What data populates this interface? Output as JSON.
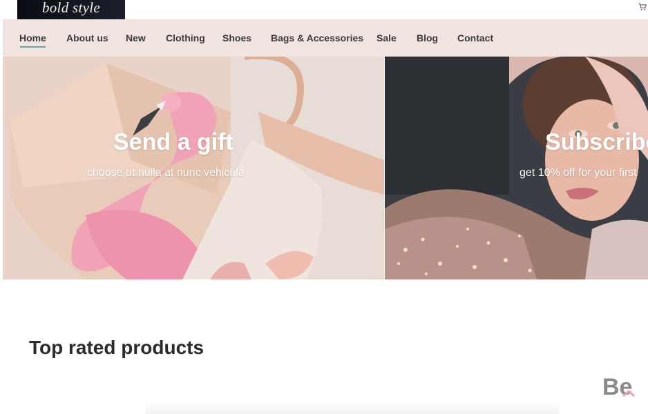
{
  "logo": {
    "text": "bold style"
  },
  "nav": {
    "items": [
      {
        "label": "Home",
        "active": true
      },
      {
        "label": "About us"
      },
      {
        "label": "New"
      },
      {
        "label": "Clothing"
      },
      {
        "label": "Shoes"
      },
      {
        "label": "Bags & Accessories"
      },
      {
        "label": "Sale"
      },
      {
        "label": "Blog"
      },
      {
        "label": "Contact"
      }
    ],
    "active_color": "#5aa9b3",
    "background": "#f1e4e1"
  },
  "banners": {
    "gift": {
      "title": "Send a gift",
      "subtitle": "choose ut nulla at nunc vehicula"
    },
    "subscribe": {
      "title": "Subscribe",
      "subtitle": "get 10% off for your first"
    }
  },
  "sections": {
    "top_rated_title": "Top rated products"
  },
  "badge": {
    "text": "Be",
    "icon": "behance-icon"
  },
  "header": {
    "cart_icon": "cart-icon"
  }
}
